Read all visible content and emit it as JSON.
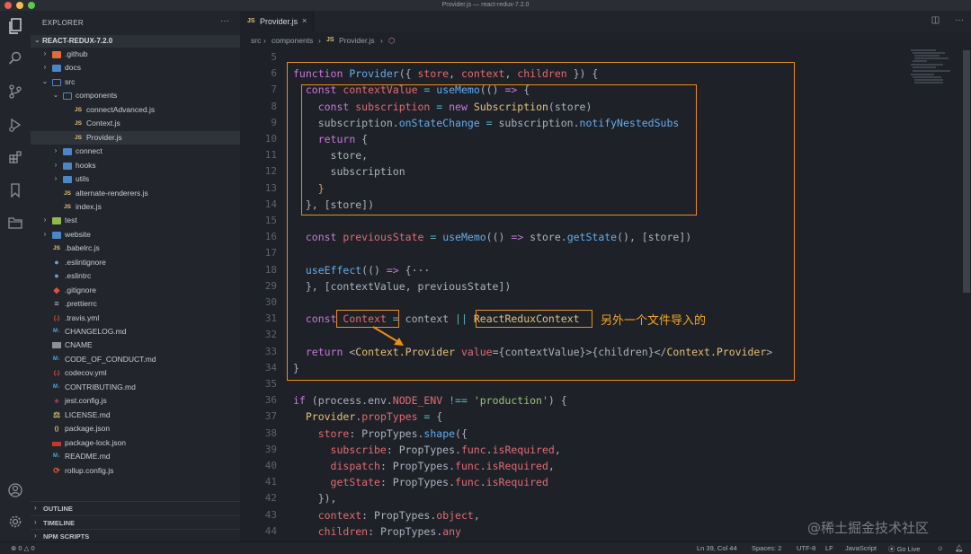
{
  "window": {
    "title": "Provider.js — react-redux-7.2.0"
  },
  "sidebar": {
    "title": "EXPLORER",
    "more": "···",
    "root": "REACT-REDUX-7.2.0",
    "items": [
      {
        "label": ".github",
        "type": "folder-git",
        "chev": "›",
        "depth": 0
      },
      {
        "label": "docs",
        "type": "folder",
        "chev": "›",
        "depth": 0
      },
      {
        "label": "src",
        "type": "folder-open",
        "chev": "⌄",
        "depth": 0
      },
      {
        "label": "components",
        "type": "folder-open",
        "chev": "⌄",
        "depth": 1
      },
      {
        "label": "connectAdvanced.js",
        "type": "js",
        "chev": "",
        "depth": 2
      },
      {
        "label": "Context.js",
        "type": "js",
        "chev": "",
        "depth": 2
      },
      {
        "label": "Provider.js",
        "type": "js",
        "chev": "",
        "depth": 2
      },
      {
        "label": "connect",
        "type": "folder",
        "chev": "›",
        "depth": 1
      },
      {
        "label": "hooks",
        "type": "folder",
        "chev": "›",
        "depth": 1
      },
      {
        "label": "utils",
        "type": "folder",
        "chev": "›",
        "depth": 1
      },
      {
        "label": "alternate-renderers.js",
        "type": "js",
        "chev": "",
        "depth": 1
      },
      {
        "label": "index.js",
        "type": "js",
        "chev": "",
        "depth": 1
      },
      {
        "label": "test",
        "type": "folder-test",
        "chev": "›",
        "depth": 0
      },
      {
        "label": "website",
        "type": "folder",
        "chev": "›",
        "depth": 0
      },
      {
        "label": ".babelrc.js",
        "type": "js",
        "chev": "",
        "depth": 0
      },
      {
        "label": ".eslintignore",
        "type": "dot",
        "chev": "",
        "depth": 0
      },
      {
        "label": ".eslintrc",
        "type": "dot",
        "chev": "",
        "depth": 0
      },
      {
        "label": ".gitignore",
        "type": "git",
        "chev": "",
        "depth": 0
      },
      {
        "label": ".prettierrc",
        "type": "pret",
        "chev": "",
        "depth": 0
      },
      {
        "label": ".travis.yml",
        "type": "yml",
        "chev": "",
        "depth": 0
      },
      {
        "label": "CHANGELOG.md",
        "type": "md",
        "chev": "",
        "depth": 0
      },
      {
        "label": "CNAME",
        "type": "cname",
        "chev": "",
        "depth": 0
      },
      {
        "label": "CODE_OF_CONDUCT.md",
        "type": "md",
        "chev": "",
        "depth": 0
      },
      {
        "label": "codecov.yml",
        "type": "yml",
        "chev": "",
        "depth": 0
      },
      {
        "label": "CONTRIBUTING.md",
        "type": "md",
        "chev": "",
        "depth": 0
      },
      {
        "label": "jest.config.js",
        "type": "jest",
        "chev": "",
        "depth": 0
      },
      {
        "label": "LICENSE.md",
        "type": "lic",
        "chev": "",
        "depth": 0
      },
      {
        "label": "package.json",
        "type": "json",
        "chev": "",
        "depth": 0
      },
      {
        "label": "package-lock.json",
        "type": "pkg",
        "chev": "",
        "depth": 0
      },
      {
        "label": "README.md",
        "type": "md",
        "chev": "",
        "depth": 0
      },
      {
        "label": "rollup.config.js",
        "type": "roll",
        "chev": "",
        "depth": 0
      }
    ],
    "panels": [
      "OUTLINE",
      "TIMELINE",
      "NPM SCRIPTS"
    ]
  },
  "tab": {
    "icon": "JS",
    "label": "Provider.js",
    "close": "×"
  },
  "breadcrumb": [
    "src",
    "›",
    "components",
    "›",
    "JS",
    "Provider.js",
    "›",
    "Provider"
  ],
  "editor": {
    "lines": [
      {
        "n": "5",
        "tokens": []
      },
      {
        "n": "6",
        "tokens": [
          [
            "kw",
            "function "
          ],
          [
            "fn",
            "Provider"
          ],
          [
            "pl",
            "({ "
          ],
          [
            "var",
            "store"
          ],
          [
            "pl",
            ", "
          ],
          [
            "var",
            "context"
          ],
          [
            "pl",
            ", "
          ],
          [
            "var",
            "children"
          ],
          [
            "pl",
            " }) {"
          ]
        ]
      },
      {
        "n": "7",
        "tokens": [
          [
            "pl",
            "  "
          ],
          [
            "kw",
            "const "
          ],
          [
            "var",
            "contextValue"
          ],
          [
            "op",
            " = "
          ],
          [
            "fn",
            "useMemo"
          ],
          [
            "pl",
            "(() "
          ],
          [
            "kw",
            "=>"
          ],
          [
            "pl",
            " {"
          ]
        ]
      },
      {
        "n": "8",
        "tokens": [
          [
            "pl",
            "    "
          ],
          [
            "kw",
            "const "
          ],
          [
            "var",
            "subscription"
          ],
          [
            "op",
            " = "
          ],
          [
            "kw",
            "new "
          ],
          [
            "cls",
            "Subscription"
          ],
          [
            "pl",
            "(store)"
          ]
        ]
      },
      {
        "n": "9",
        "tokens": [
          [
            "pl",
            "    subscription."
          ],
          [
            "fn",
            "onStateChange"
          ],
          [
            "op",
            " = "
          ],
          [
            "pl",
            "subscription."
          ],
          [
            "fn",
            "notifyNestedSubs"
          ]
        ]
      },
      {
        "n": "10",
        "tokens": [
          [
            "pl",
            "    "
          ],
          [
            "kw",
            "return"
          ],
          [
            "pl",
            " {"
          ]
        ]
      },
      {
        "n": "11",
        "tokens": [
          [
            "pl",
            "      store,"
          ]
        ]
      },
      {
        "n": "12",
        "tokens": [
          [
            "pl",
            "      subscription"
          ]
        ]
      },
      {
        "n": "13",
        "tokens": [
          [
            "pl",
            "    "
          ],
          [
            "brk",
            "}"
          ]
        ]
      },
      {
        "n": "14",
        "tokens": [
          [
            "pl",
            "  }, [store])"
          ]
        ]
      },
      {
        "n": "15",
        "tokens": []
      },
      {
        "n": "16",
        "tokens": [
          [
            "pl",
            "  "
          ],
          [
            "kw",
            "const "
          ],
          [
            "var",
            "previousState"
          ],
          [
            "op",
            " = "
          ],
          [
            "fn",
            "useMemo"
          ],
          [
            "pl",
            "(() "
          ],
          [
            "kw",
            "=>"
          ],
          [
            "pl",
            " store."
          ],
          [
            "fn",
            "getState"
          ],
          [
            "pl",
            "(), [store])"
          ]
        ]
      },
      {
        "n": "17",
        "tokens": []
      },
      {
        "n": "18",
        "tokens": [
          [
            "pl",
            "  "
          ],
          [
            "fn",
            "useEffect"
          ],
          [
            "pl",
            "(() "
          ],
          [
            "kw",
            "=>"
          ],
          [
            "pl",
            " {···"
          ]
        ]
      },
      {
        "n": "29",
        "tokens": [
          [
            "pl",
            "  }, [contextValue, previousState])"
          ]
        ]
      },
      {
        "n": "30",
        "tokens": []
      },
      {
        "n": "31",
        "tokens": [
          [
            "pl",
            "  "
          ],
          [
            "kw",
            "const "
          ],
          [
            "var",
            "Context"
          ],
          [
            "op",
            " = "
          ],
          [
            "pl",
            "context "
          ],
          [
            "op",
            "||"
          ],
          [
            "pl",
            " "
          ],
          [
            "cls",
            "ReactReduxContext"
          ]
        ]
      },
      {
        "n": "32",
        "tokens": []
      },
      {
        "n": "33",
        "tokens": [
          [
            "pl",
            "  "
          ],
          [
            "kw",
            "return"
          ],
          [
            "pl",
            " <"
          ],
          [
            "cls",
            "Context.Provider"
          ],
          [
            "pl",
            " "
          ],
          [
            "prop",
            "value"
          ],
          [
            "pl",
            "={contextValue}>{children}</"
          ],
          [
            "cls",
            "Context.Provider"
          ],
          [
            "pl",
            ">"
          ]
        ]
      },
      {
        "n": "34",
        "tokens": [
          [
            "pl",
            "}"
          ]
        ]
      },
      {
        "n": "35",
        "tokens": []
      },
      {
        "n": "36",
        "tokens": [
          [
            "kw",
            "if"
          ],
          [
            "pl",
            " (process.env."
          ],
          [
            "var",
            "NODE_ENV"
          ],
          [
            "op",
            " !== "
          ],
          [
            "str",
            "'production'"
          ],
          [
            "pl",
            ") {"
          ]
        ]
      },
      {
        "n": "37",
        "tokens": [
          [
            "pl",
            "  "
          ],
          [
            "cls",
            "Provider"
          ],
          [
            "pl",
            "."
          ],
          [
            "prop",
            "propTypes"
          ],
          [
            "op",
            " = "
          ],
          [
            "pl",
            "{"
          ]
        ]
      },
      {
        "n": "38",
        "tokens": [
          [
            "pl",
            "    "
          ],
          [
            "prop",
            "store"
          ],
          [
            "pl",
            ": PropTypes."
          ],
          [
            "fn",
            "shape"
          ],
          [
            "pl",
            "({"
          ]
        ]
      },
      {
        "n": "39",
        "tokens": [
          [
            "pl",
            "      "
          ],
          [
            "prop",
            "subscribe"
          ],
          [
            "pl",
            ": PropTypes."
          ],
          [
            "prop",
            "func"
          ],
          [
            "pl",
            "."
          ],
          [
            "prop",
            "isRequired"
          ],
          [
            "pl",
            ","
          ]
        ]
      },
      {
        "n": "40",
        "tokens": [
          [
            "pl",
            "      "
          ],
          [
            "prop",
            "dispatch"
          ],
          [
            "pl",
            ": PropTypes."
          ],
          [
            "prop",
            "func"
          ],
          [
            "pl",
            "."
          ],
          [
            "prop",
            "isRequired"
          ],
          [
            "pl",
            ","
          ]
        ]
      },
      {
        "n": "41",
        "tokens": [
          [
            "pl",
            "      "
          ],
          [
            "prop",
            "getState"
          ],
          [
            "pl",
            ": PropTypes."
          ],
          [
            "prop",
            "func"
          ],
          [
            "pl",
            "."
          ],
          [
            "prop",
            "isRequired"
          ]
        ]
      },
      {
        "n": "42",
        "tokens": [
          [
            "pl",
            "    }),"
          ]
        ]
      },
      {
        "n": "43",
        "tokens": [
          [
            "pl",
            "    "
          ],
          [
            "prop",
            "context"
          ],
          [
            "pl",
            ": PropTypes."
          ],
          [
            "prop",
            "object"
          ],
          [
            "pl",
            ","
          ]
        ]
      },
      {
        "n": "44",
        "tokens": [
          [
            "pl",
            "    "
          ],
          [
            "prop",
            "children"
          ],
          [
            "pl",
            ": PropTypes."
          ],
          [
            "prop",
            "any"
          ]
        ]
      }
    ],
    "annotation": "另外一个文件导入的"
  },
  "statusbar": {
    "errors": "⊗ 0 △ 0",
    "position": "Ln 39, Col 44",
    "spaces": "Spaces: 2",
    "encoding": "UTF-8",
    "eol": "LF",
    "language": "JavaScript",
    "golive": "⦿ Go Live"
  },
  "watermark": "@稀土掘金技术社区"
}
